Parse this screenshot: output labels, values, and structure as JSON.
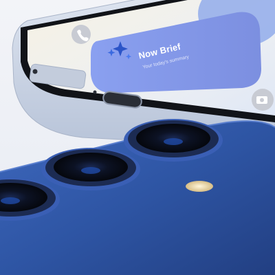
{
  "scene": {
    "description_free": true,
    "notification": {
      "title": "Now Brief",
      "subtitle": "Your today's summary"
    },
    "icons": [
      "phone-icon",
      "sparkle-icon",
      "camera-icon"
    ],
    "colors": {
      "phone_back": "#2f57a8",
      "camera_ring": "#3a5fb5",
      "frame_silver": "#c9d3e4",
      "screen_bg": "#f4f1e8",
      "notification_pill": "#7f98ee",
      "flash": "#f1deb0"
    }
  }
}
